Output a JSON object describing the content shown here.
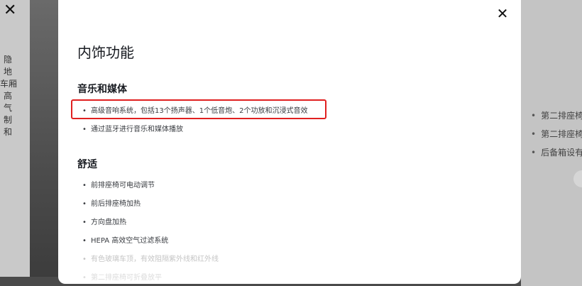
{
  "background": {
    "left_close_glyph": "✕",
    "left_text_lines": [
      "隐",
      "地",
      "车厢",
      "高",
      "气",
      "制",
      "和"
    ],
    "right_items": [
      "第二排座椅",
      "第二排座椅",
      "后备箱设有"
    ]
  },
  "modal": {
    "close_glyph": "✕",
    "title": "内饰功能",
    "sections": [
      {
        "heading": "音乐和媒体",
        "items": [
          "高级音响系统，包括13个扬声器、1个低音炮、2个功放和沉浸式音效",
          "通过蓝牙进行音乐和媒体播放"
        ]
      },
      {
        "heading": "舒适",
        "items": [
          "前排座椅可电动调节",
          "前后排座椅加热",
          "方向盘加热",
          "HEPA 高效空气过滤系统",
          "有色玻璃车顶，有效阻隔紫外线和红外线",
          "第二排座椅可折叠放平"
        ]
      }
    ]
  },
  "highlight": {
    "color": "#e02020"
  }
}
